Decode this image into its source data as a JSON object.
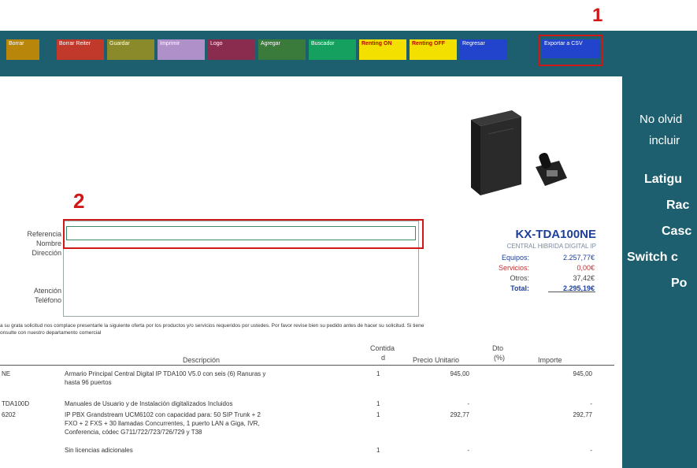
{
  "toolbar": {
    "buttons": [
      {
        "label": "Borrar",
        "bg": "#b8860b"
      },
      {
        "label": "Borrar Reiter",
        "bg": "#c0392b"
      },
      {
        "label": "Guardar",
        "bg": "#8a8a2a"
      },
      {
        "label": "Imprimir",
        "bg": "#b090c8"
      },
      {
        "label": "Logo",
        "bg": "#8a2c4e"
      },
      {
        "label": "Agregar",
        "bg": "#3a7a3a"
      },
      {
        "label": "Buscador",
        "bg": "#16a060"
      },
      {
        "label": "Renting ON",
        "bg": "#f4e000"
      },
      {
        "label": "Renting OFF",
        "bg": "#f4e000"
      },
      {
        "label": "Regresar",
        "bg": "#2244cc"
      },
      {
        "label": "Exportar a CSV",
        "bg": "#2244cc"
      }
    ],
    "callout_1": "1",
    "callout_2": "2"
  },
  "side_panel": {
    "lines": [
      "No olvid",
      "incluir",
      "Latigu",
      "Rac",
      "Casc",
      "Switch c",
      "Po"
    ]
  },
  "form": {
    "referencia_label": "Referencia",
    "nombre_label": "Nombre",
    "direccion_label": "Dirección",
    "atencion_label": "Atención",
    "telefono_label": "Teléfono",
    "referencia_value": ""
  },
  "summary": {
    "model": "KX-TDA100NE",
    "subtitle": "CENTRAL HIBRIDA DIGITAL IP",
    "rows": [
      {
        "label": "Equipos:",
        "value": "2.257,77€",
        "color": "#1d3f9a"
      },
      {
        "label": "Servicios:",
        "value": "0,00€",
        "color": "#c03030"
      },
      {
        "label": "Otros:",
        "value": "37,42€",
        "color": "#444444"
      },
      {
        "label": "Total:",
        "value": "2.295,19€",
        "color": "#1d3f9a"
      }
    ]
  },
  "note": {
    "line1": "a su grata solicitud nos complace presentarle la siguiente oferta por los productos y/o servicios requeridos por ustedes. Por favor revise bien su pedido antes de hacer su solicitud. Si tiene",
    "line2": "onsulte con nuestro departamento comercial"
  },
  "table": {
    "headers": {
      "descripcion": "Descripción",
      "cantidad_a": "Contida",
      "cantidad_b": "d",
      "precio": "Precio Unitario",
      "dto_a": "Dto",
      "dto_b": "(%)",
      "importe": "Importe"
    },
    "rows": [
      {
        "code": "NE",
        "desc": [
          "Armario Principal Central Digital IP TDA100 V5.0 con seis (6) Ranuras y",
          "hasta 96 puertos"
        ],
        "qty": "1",
        "price": "945,00",
        "importe": "945,00"
      },
      {
        "code": "TDA100D",
        "desc": [
          "Manuales de Usuario y de Instalación digitalizados Incluidos"
        ],
        "qty": "1",
        "price": "-",
        "importe": "-"
      },
      {
        "code": "6202",
        "desc": [
          "IP PBX Grandstream UCM6102  con capacidad para: 50 SIP Trunk + 2",
          "FXO + 2 FXS + 30 llamadas Concurrentes,  1 puerto LAN a Giga, IVR,",
          "Conferencia, códec G711/722/723/726/729 y T38"
        ],
        "qty": "1",
        "price": "292,77",
        "importe": "292,77"
      },
      {
        "code": "",
        "desc": [
          "Sin licencias adicionales"
        ],
        "qty": "1",
        "price": "-",
        "importe": "-"
      }
    ]
  }
}
